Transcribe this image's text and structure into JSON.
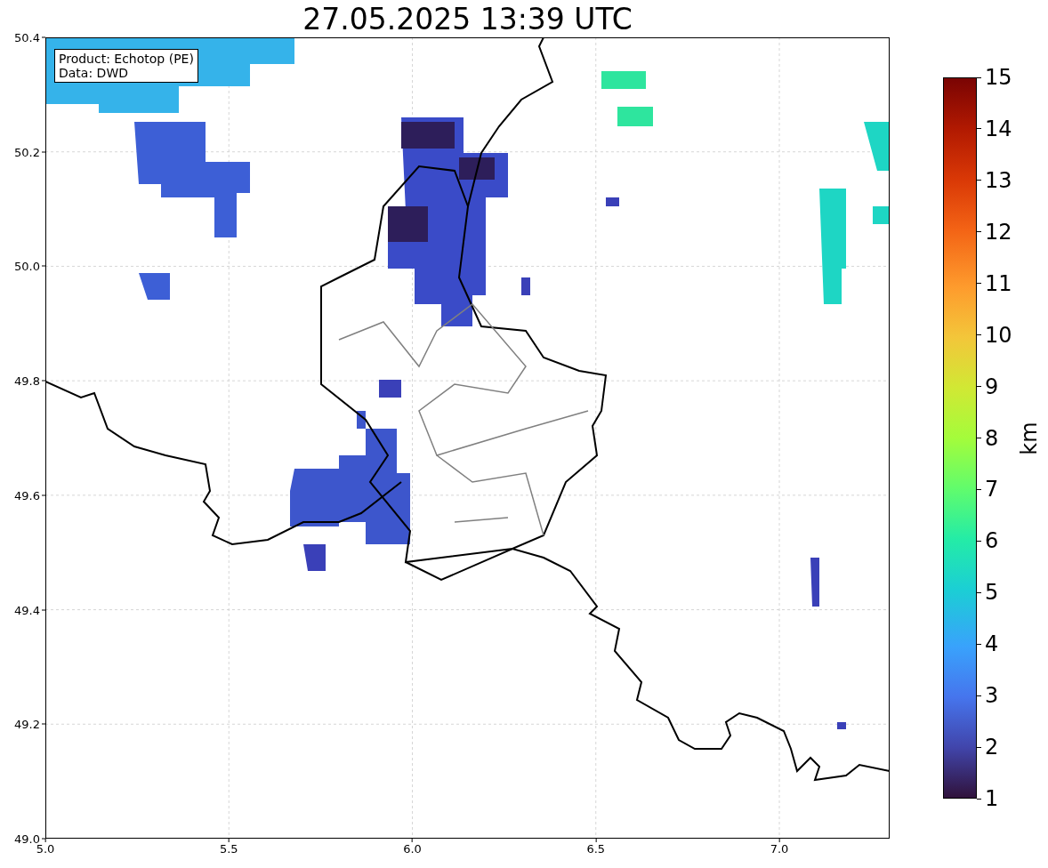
{
  "title": "27.05.2025 13:39 UTC",
  "legend": {
    "lines": [
      "Product: Echotop (PE)",
      "Data: DWD"
    ]
  },
  "x_axis": {
    "ticks": [
      "5.0",
      "5.5",
      "6.0",
      "6.5",
      "7.0"
    ]
  },
  "y_axis": {
    "ticks": [
      "50.4",
      "50.2",
      "50.0",
      "49.8",
      "49.6",
      "49.4",
      "49.2",
      "49.0"
    ]
  },
  "colorbar": {
    "label": "km",
    "ticks": [
      "15",
      "14",
      "13",
      "12",
      "11",
      "10",
      "9",
      "8",
      "7",
      "6",
      "5",
      "4",
      "3",
      "2",
      "1"
    ]
  }
}
